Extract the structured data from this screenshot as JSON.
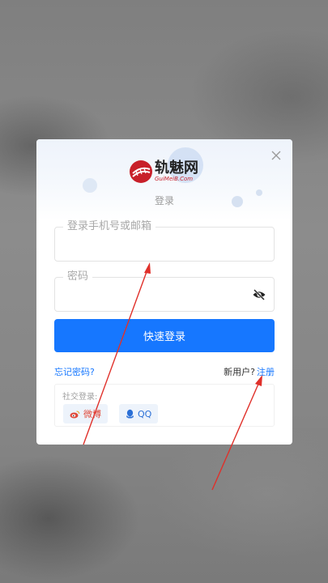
{
  "dialog": {
    "logo": {
      "cn_text": "轨魅网",
      "en_text": "GuiMeiB.Com",
      "brand_color": "#c8202a"
    },
    "subtitle": "登录",
    "account_field": {
      "label": "登录手机号或邮箱",
      "value": ""
    },
    "password_field": {
      "label": "密码",
      "value": ""
    },
    "login_button": "快速登录",
    "forgot_password": "忘记密码?",
    "new_user_prompt": "新用户?",
    "register_link": "注册",
    "social": {
      "label": "社交登录:",
      "weibo": "微博",
      "qq": "QQ"
    }
  },
  "colors": {
    "primary": "#1677ff",
    "annotation_arrow": "#e0302a"
  }
}
